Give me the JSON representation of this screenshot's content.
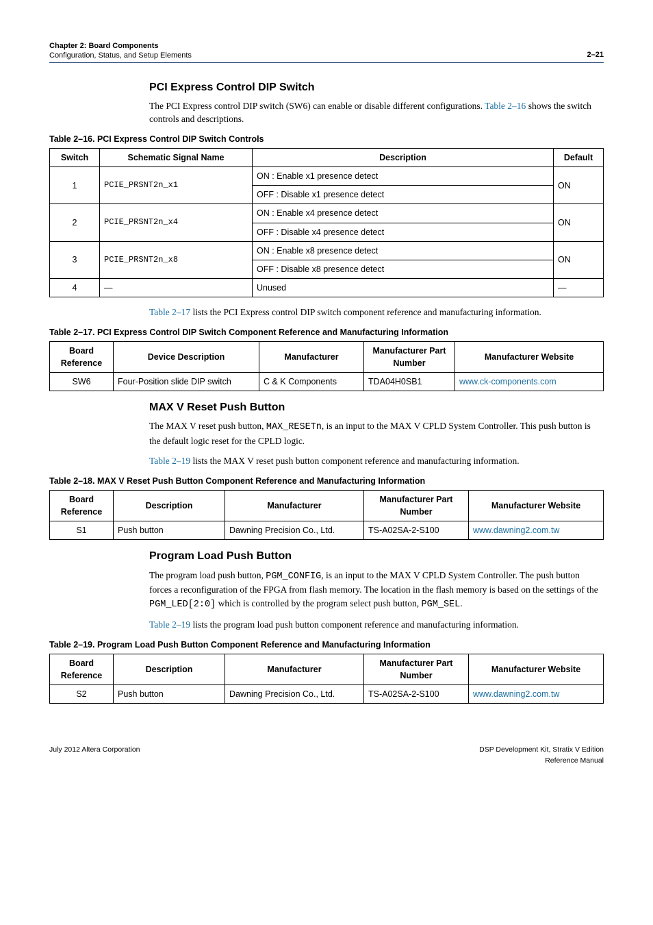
{
  "header": {
    "chapter_line": "Chapter 2: Board Components",
    "subline": "Configuration, Status, and Setup Elements",
    "page_num": "2–21"
  },
  "sec1": {
    "title": "PCI Express Control DIP Switch",
    "p1_a": "The PCI Express control DIP switch (SW6) can enable or disable different configurations. ",
    "p1_link": "Table 2–16",
    "p1_b": " shows the switch controls and descriptions."
  },
  "table16": {
    "caption": "Table 2–16.  PCI Express Control DIP Switch Controls",
    "h1": "Switch",
    "h2": "Schematic Signal Name",
    "h3": "Description",
    "h4": "Default",
    "r1_sw": "1",
    "r1_sig": "PCIE_PRSNT2n_x1",
    "r1_d1": "ON : Enable x1 presence detect",
    "r1_d2": "OFF : Disable x1 presence detect",
    "r1_def": "ON",
    "r2_sw": "2",
    "r2_sig": "PCIE_PRSNT2n_x4",
    "r2_d1": "ON : Enable x4 presence detect",
    "r2_d2": "OFF : Disable x4 presence detect",
    "r2_def": "ON",
    "r3_sw": "3",
    "r3_sig": "PCIE_PRSNT2n_x8",
    "r3_d1": "ON : Enable x8 presence detect",
    "r3_d2": "OFF : Disable x8 presence detect",
    "r3_def": "ON",
    "r4_sw": "4",
    "r4_sig": "—",
    "r4_d": "Unused",
    "r4_def": "—"
  },
  "after16": {
    "link": "Table 2–17",
    "rest": " lists the PCI Express control DIP switch component reference and manufacturing information."
  },
  "table17": {
    "caption": "Table 2–17.  PCI Express Control DIP Switch Component Reference and Manufacturing Information",
    "h1": "Board Reference",
    "h2": "Device Description",
    "h3": "Manufacturer",
    "h4": "Manufacturer Part Number",
    "h5": "Manufacturer Website",
    "ref": "SW6",
    "desc": "Four-Position slide DIP switch",
    "man": "C & K Components",
    "part": "TDA04H0SB1",
    "url": "www.ck-components.com"
  },
  "sec2": {
    "title": "MAX V Reset Push Button",
    "p1_a": "The MAX V reset push button, ",
    "p1_code": "MAX_RESETn",
    "p1_b": ", is an input to the MAX V CPLD System Controller. This push button is the default logic reset for the CPLD logic.",
    "p2_link": "Table 2–19",
    "p2_rest": " lists the MAX V reset push button component reference and manufacturing information."
  },
  "table18": {
    "caption": "Table 2–18.  MAX V Reset Push Button Component Reference and Manufacturing Information",
    "h1": "Board Reference",
    "h2": "Description",
    "h3": "Manufacturer",
    "h4": "Manufacturer Part Number",
    "h5": "Manufacturer Website",
    "ref": "S1",
    "desc": "Push button",
    "man": "Dawning Precision Co., Ltd.",
    "part": "TS-A02SA-2-S100",
    "url": "www.dawning2.com.tw"
  },
  "sec3": {
    "title": "Program Load Push Button",
    "p1_a": "The program load push button, ",
    "p1_code1": "PGM_CONFIG",
    "p1_b": ", is an input to the MAX V CPLD System Controller. The push button forces a reconfiguration of the FPGA from flash memory. The location in the flash memory is based on the settings of the ",
    "p1_code2": "PGM_LED[2:0]",
    "p1_c": " which is controlled by the program select push button, ",
    "p1_code3": "PGM_SEL",
    "p1_d": ".",
    "p2_link": "Table 2–19",
    "p2_rest": " lists the program load push button component reference and manufacturing information."
  },
  "table19": {
    "caption": "Table 2–19.  Program Load Push Button Component Reference and Manufacturing Information",
    "h1": "Board Reference",
    "h2": "Description",
    "h3": "Manufacturer",
    "h4": "Manufacturer Part Number",
    "h5": "Manufacturer Website",
    "ref": "S2",
    "desc": "Push button",
    "man": "Dawning Precision Co., Ltd.",
    "part": "TS-A02SA-2-S100",
    "url": "www.dawning2.com.tw"
  },
  "footer": {
    "left": "July 2012   Altera Corporation",
    "right1": "DSP Development Kit, Stratix V Edition",
    "right2": "Reference Manual"
  }
}
